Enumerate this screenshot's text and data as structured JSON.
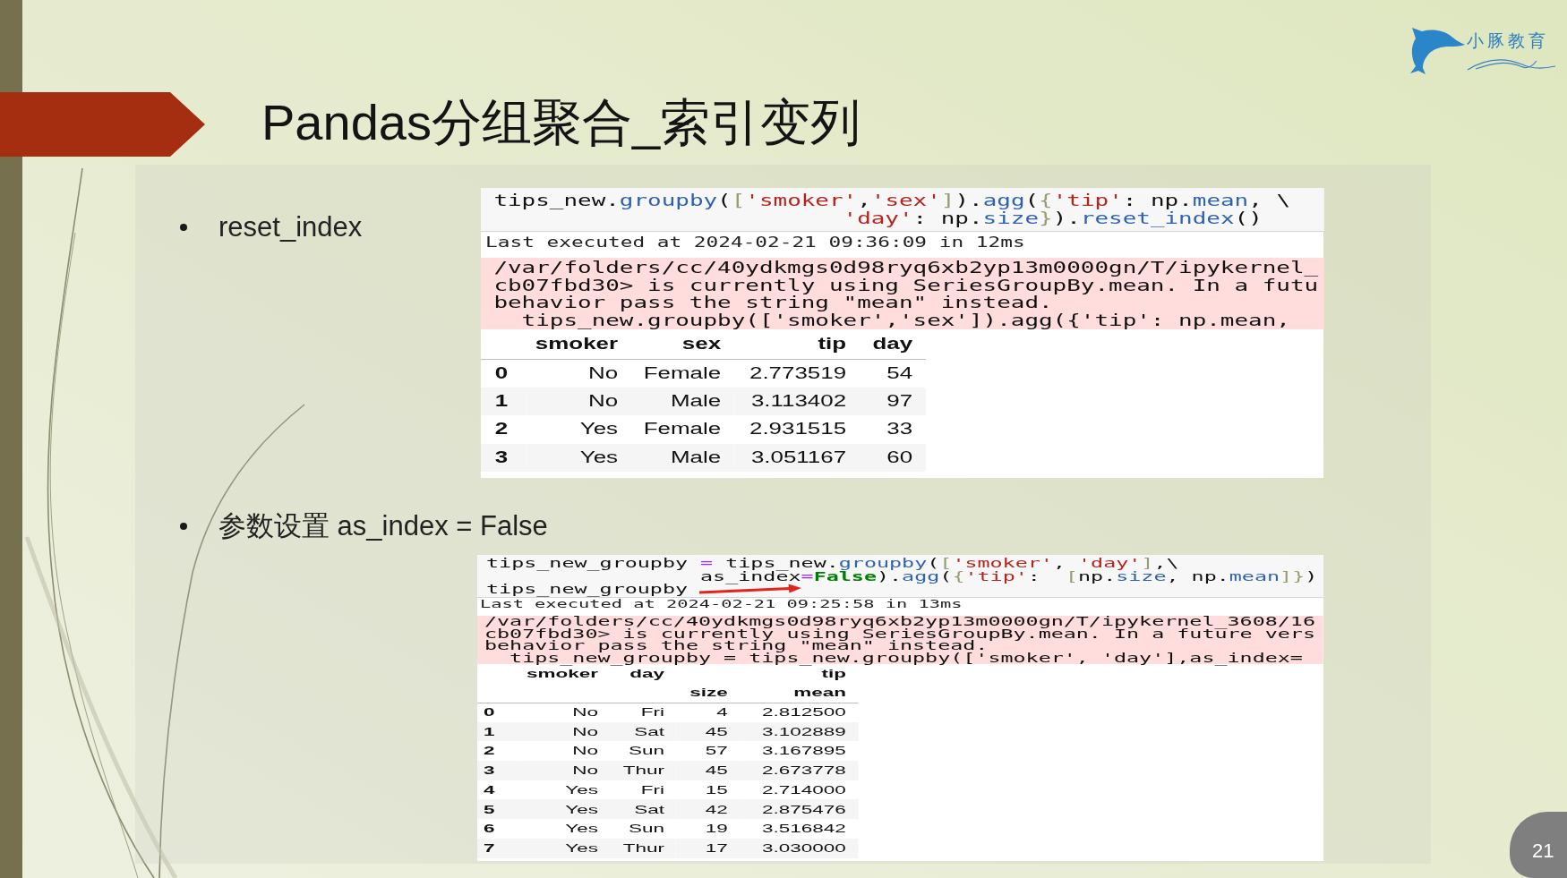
{
  "slide": {
    "title": "Pandas分组聚合_索引变列",
    "logo_text": "小豚教育",
    "page_number": "21"
  },
  "sections": [
    {
      "bullet": "reset_index",
      "cell": {
        "code_lines": [
          [
            {
              "text": "tips_new.",
              "kind": "plain"
            },
            {
              "text": "groupby",
              "kind": "method"
            },
            {
              "text": "(",
              "kind": "plain"
            },
            {
              "text": "[",
              "kind": "bracket"
            },
            {
              "text": "'smoker'",
              "kind": "string"
            },
            {
              "text": ",",
              "kind": "plain"
            },
            {
              "text": "'sex'",
              "kind": "string"
            },
            {
              "text": "]",
              "kind": "bracket"
            },
            {
              "text": ").",
              "kind": "plain"
            },
            {
              "text": "agg",
              "kind": "method"
            },
            {
              "text": "(",
              "kind": "plain"
            },
            {
              "text": "{",
              "kind": "bracket"
            },
            {
              "text": "'tip'",
              "kind": "string"
            },
            {
              "text": ": np.",
              "kind": "plain"
            },
            {
              "text": "mean",
              "kind": "method"
            },
            {
              "text": ", \\",
              "kind": "plain"
            }
          ],
          [
            {
              "text": "                         'day'",
              "kind": "string"
            },
            {
              "text": ": np.",
              "kind": "plain"
            },
            {
              "text": "size",
              "kind": "method"
            },
            {
              "text": "}",
              "kind": "bracket"
            },
            {
              "text": ").",
              "kind": "plain"
            },
            {
              "text": "reset_index",
              "kind": "method"
            },
            {
              "text": "()",
              "kind": "plain"
            }
          ]
        ],
        "execution_note": "Last executed at 2024-02-21 09:36:09 in 12ms",
        "warning_lines": [
          "/var/folders/cc/40ydkmgs0d98ryq6xb2yp13m0000gn/T/ipykernel_",
          "cb07fbd30> is currently using SeriesGroupBy.mean. In a futu",
          "behavior pass the string \"mean\" instead.",
          "  tips_new.groupby(['smoker','sex']).agg({'tip': np.mean,"
        ],
        "table": {
          "columns": [
            {
              "label": "smoker"
            },
            {
              "label": "sex"
            },
            {
              "label": "tip"
            },
            {
              "label": "day"
            }
          ],
          "rows": [
            {
              "index": "0",
              "cells": [
                "No",
                "Female",
                "2.773519",
                "54"
              ]
            },
            {
              "index": "1",
              "cells": [
                "No",
                "Male",
                "3.113402",
                "97"
              ]
            },
            {
              "index": "2",
              "cells": [
                "Yes",
                "Female",
                "2.931515",
                "33"
              ]
            },
            {
              "index": "3",
              "cells": [
                "Yes",
                "Male",
                "3.051167",
                "60"
              ]
            }
          ]
        }
      }
    },
    {
      "bullet": "参数设置 as_index = False",
      "cell": {
        "code_lines": [
          [
            {
              "text": "tips_new_groupby ",
              "kind": "plain"
            },
            {
              "text": "=",
              "kind": "operator"
            },
            {
              "text": " tips_new.",
              "kind": "plain"
            },
            {
              "text": "groupby",
              "kind": "method"
            },
            {
              "text": "(",
              "kind": "plain"
            },
            {
              "text": "[",
              "kind": "bracket"
            },
            {
              "text": "'smoker'",
              "kind": "string"
            },
            {
              "text": ", ",
              "kind": "plain"
            },
            {
              "text": "'day'",
              "kind": "string"
            },
            {
              "text": "]",
              "kind": "bracket"
            },
            {
              "text": ",\\",
              "kind": "plain"
            }
          ],
          [
            {
              "text": "                 as_index",
              "kind": "plain"
            },
            {
              "text": "=",
              "kind": "operator"
            },
            {
              "text": "False",
              "kind": "keyword"
            },
            {
              "text": ").",
              "kind": "plain"
            },
            {
              "text": "agg",
              "kind": "method"
            },
            {
              "text": "(",
              "kind": "plain"
            },
            {
              "text": "{",
              "kind": "bracket"
            },
            {
              "text": "'tip'",
              "kind": "string"
            },
            {
              "text": ":  ",
              "kind": "plain"
            },
            {
              "text": "[",
              "kind": "bracket"
            },
            {
              "text": "np.",
              "kind": "plain"
            },
            {
              "text": "size",
              "kind": "method"
            },
            {
              "text": ", np.",
              "kind": "plain"
            },
            {
              "text": "mean",
              "kind": "method"
            },
            {
              "text": "]",
              "kind": "bracket"
            },
            {
              "text": "}",
              "kind": "bracket"
            },
            {
              "text": ")",
              "kind": "plain"
            }
          ],
          [
            {
              "text": "tips_new_groupby",
              "kind": "plain"
            }
          ]
        ],
        "execution_note": "Last executed at 2024-02-21 09:25:58 in 13ms",
        "warning_lines": [
          "/var/folders/cc/40ydkmgs0d98ryq6xb2yp13m0000gn/T/ipykernel_3608/16",
          "cb07fbd30> is currently using SeriesGroupBy.mean. In a future vers",
          "behavior pass the string \"mean\" instead.",
          "  tips_new_groupby = tips_new.groupby(['smoker', 'day'],as_index="
        ],
        "table": {
          "columns": [
            {
              "label": "smoker"
            },
            {
              "label": "day"
            },
            {
              "label": "tip",
              "colspan": 2,
              "subcolumns": [
                "size",
                "mean"
              ]
            }
          ],
          "rows": [
            {
              "index": "0",
              "cells": [
                "No",
                "Fri",
                "4",
                "2.812500"
              ]
            },
            {
              "index": "1",
              "cells": [
                "No",
                "Sat",
                "45",
                "3.102889"
              ]
            },
            {
              "index": "2",
              "cells": [
                "No",
                "Sun",
                "57",
                "3.167895"
              ]
            },
            {
              "index": "3",
              "cells": [
                "No",
                "Thur",
                "45",
                "2.673778"
              ]
            },
            {
              "index": "4",
              "cells": [
                "Yes",
                "Fri",
                "15",
                "2.714000"
              ]
            },
            {
              "index": "5",
              "cells": [
                "Yes",
                "Sat",
                "42",
                "2.875476"
              ]
            },
            {
              "index": "6",
              "cells": [
                "Yes",
                "Sun",
                "19",
                "3.516842"
              ]
            },
            {
              "index": "7",
              "cells": [
                "Yes",
                "Thur",
                "17",
                "3.030000"
              ]
            }
          ]
        }
      }
    }
  ]
}
